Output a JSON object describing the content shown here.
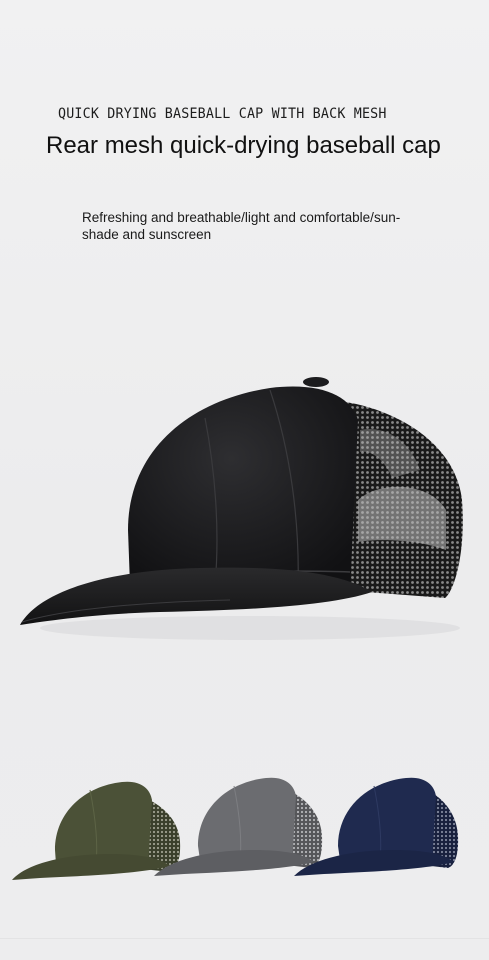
{
  "header": {
    "eyebrow": "QUICK DRYING BASEBALL CAP WITH BACK MESH",
    "title": "Rear mesh quick-drying baseball cap",
    "subtitle": "Refreshing and breathable/light and comfortable/sun-shade and sunscreen"
  },
  "hero": {
    "color": "#1b1b1d",
    "icon": "baseball-cap-image"
  },
  "variants": [
    {
      "color": "#4b5137",
      "icon": "baseball-cap-image"
    },
    {
      "color": "#67686b",
      "icon": "baseball-cap-image"
    },
    {
      "color": "#1f2a4f",
      "icon": "baseball-cap-image"
    }
  ]
}
